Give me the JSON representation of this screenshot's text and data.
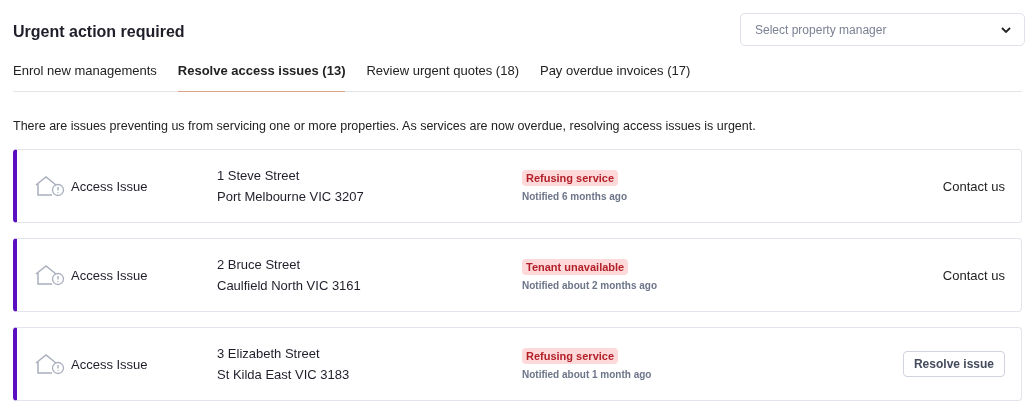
{
  "heading": "Urgent action required",
  "manager_select": {
    "placeholder": "Select property manager"
  },
  "tabs": [
    {
      "label": "Enrol new managements",
      "selected": false
    },
    {
      "label": "Resolve access issues (13)",
      "selected": true
    },
    {
      "label": "Review urgent quotes (18)",
      "selected": false
    },
    {
      "label": "Pay overdue invoices (17)",
      "selected": false
    }
  ],
  "description": "There are issues preventing us from servicing one or more properties. As services are now overdue, resolving access issues is urgent.",
  "issues": [
    {
      "type": "Access Issue",
      "street": "1 Steve Street",
      "suburb": "Port Melbourne VIC 3207",
      "status": "Refusing service",
      "notified": "Notified 6 months ago",
      "action": {
        "kind": "link",
        "label": "Contact us"
      }
    },
    {
      "type": "Access Issue",
      "street": "2 Bruce Street",
      "suburb": "Caulfield North VIC 3161",
      "status": "Tenant unavailable",
      "notified": "Notified about 2 months ago",
      "action": {
        "kind": "link",
        "label": "Contact us"
      }
    },
    {
      "type": "Access Issue",
      "street": "3 Elizabeth Street",
      "suburb": "St Kilda East VIC 3183",
      "status": "Refusing service",
      "notified": "Notified about 1 month ago",
      "action": {
        "kind": "outlined",
        "label": "Resolve issue"
      }
    }
  ]
}
